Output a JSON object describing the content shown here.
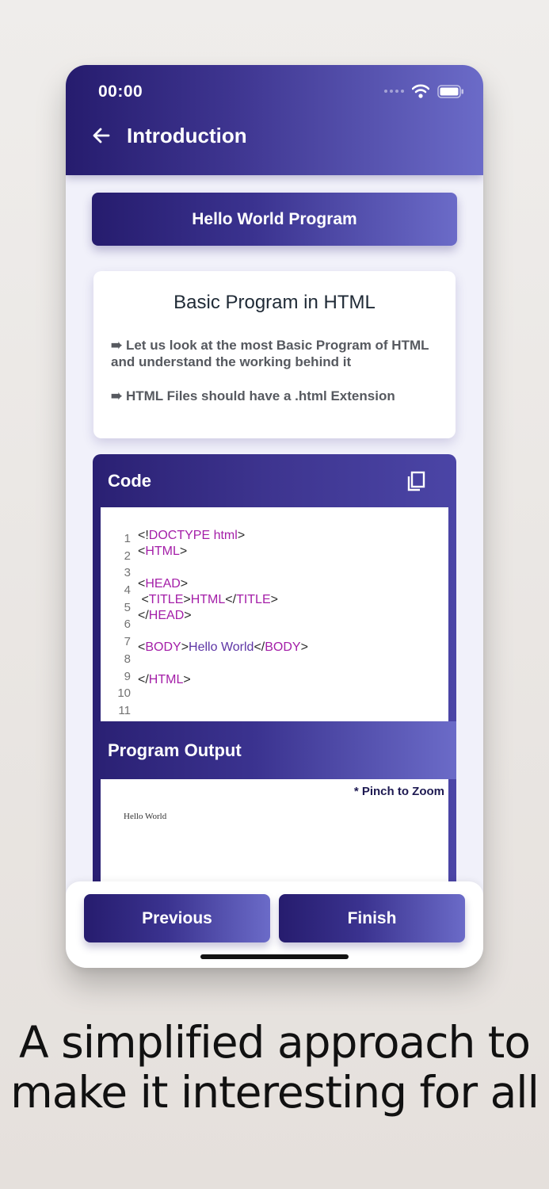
{
  "status_bar": {
    "time": "00:00"
  },
  "app_bar": {
    "title": "Introduction",
    "back_icon": "arrow-left-icon"
  },
  "banner": {
    "title": "Hello World Program"
  },
  "info_card": {
    "title": "Basic Program in HTML",
    "points": [
      "➠ Let us look at the most Basic Program of HTML and understand the working behind it",
      "➠ HTML Files should have a .html Extension"
    ]
  },
  "code_section": {
    "label": "Code",
    "copy_icon": "copy-icon",
    "line_numbers": [
      "1",
      "2",
      "3",
      "4",
      "5",
      "6",
      "7",
      "8",
      "9",
      "10",
      "11"
    ],
    "lines": {
      "l1": {
        "open": "<!",
        "tag": "DOCTYPE html",
        "close": ">"
      },
      "l2": {
        "open": "<",
        "tag": "HTML",
        "close": ">"
      },
      "l4": {
        "open": "<",
        "tag": "HEAD",
        "close": ">"
      },
      "l5": {
        "open": " <",
        "tag": "TITLE",
        "mid": ">",
        "text": "HTML",
        "open2": "</",
        "tag2": "TITLE",
        "close": ">"
      },
      "l6": {
        "open": "</",
        "tag": "HEAD",
        "close": ">"
      },
      "l8": {
        "open": "<",
        "tag": "BODY",
        "mid": ">",
        "text": "Hello World",
        "open2": "</",
        "tag2": "BODY",
        "close": ">"
      },
      "l10": {
        "open": "</",
        "tag": "HTML",
        "close": ">"
      }
    }
  },
  "output_section": {
    "label": "Program Output",
    "hint": "* Pinch to Zoom",
    "rendered_text": "Hello World"
  },
  "navigation": {
    "previous": "Previous",
    "finish": "Finish"
  },
  "caption": {
    "line1": "A simplified approach to",
    "line2": "make it interesting for all"
  },
  "colors": {
    "gradient_start": "#261c6e",
    "gradient_end": "#6b6bc8",
    "tag": "#a41ea8",
    "text": "#5d35a5"
  }
}
